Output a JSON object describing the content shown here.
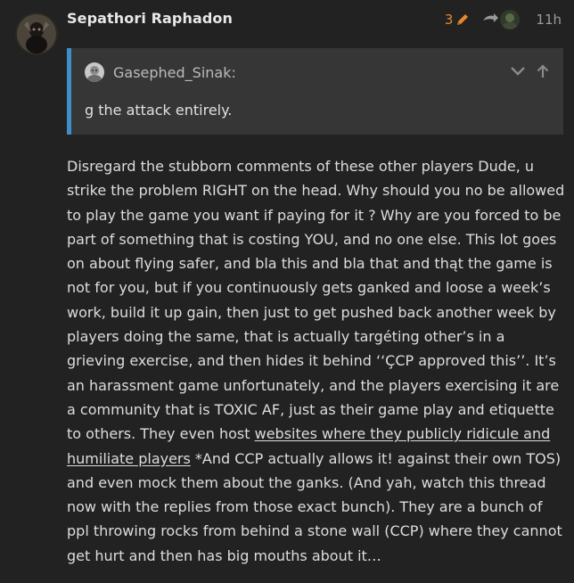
{
  "post": {
    "username": "Sepathori Raphadon",
    "edit_count": "3",
    "timestamp": "11h",
    "icons": {
      "edit": "pencil-icon",
      "reply": "reply-arrow-icon",
      "expand": "chevron-down-icon",
      "jump": "arrow-up-icon"
    },
    "accent_colors": {
      "edit": "#e48a2c",
      "quote_border": "#3d8ec9"
    },
    "quote": {
      "author": "Gasephed_Sinak:",
      "text": "g the attack entirely."
    },
    "body": {
      "before_link": "Disregard the stubborn comments of these other players Dude, u strike the problem RIGHT on the head. Why should you no be allowed to play the game you want if paying for it ? Why are you forced to be part of something that is costing YOU, and no one else. This lot goes on about flying safer, and bla this and bla that and thąt the game is not for you, but if you continuously gets ganked and loose a week’s work, build it up gain, then just to get pushed back another week by players doing the same, that is actually targéting other’s in a grieving exercise, and then hides it behind ‘‘ÇCP approved this’’. It’s an harassment game unfortunately, and the players exercising it are a community that is TOXIC AF, just as their game play and etiquette to others. They even host ",
      "link": "websites where they publicly ridicule and humiliate players",
      "after_link": " *And CCP actually allows it! against their own TOS) and even mock them about the ganks. (And yah, watch this thread now with the replies from those exact bunch). They are a bunch of ppl throwing rocks from behind a stone wall (CCP) where they cannot get hurt and then has big mouths about it…"
    }
  }
}
